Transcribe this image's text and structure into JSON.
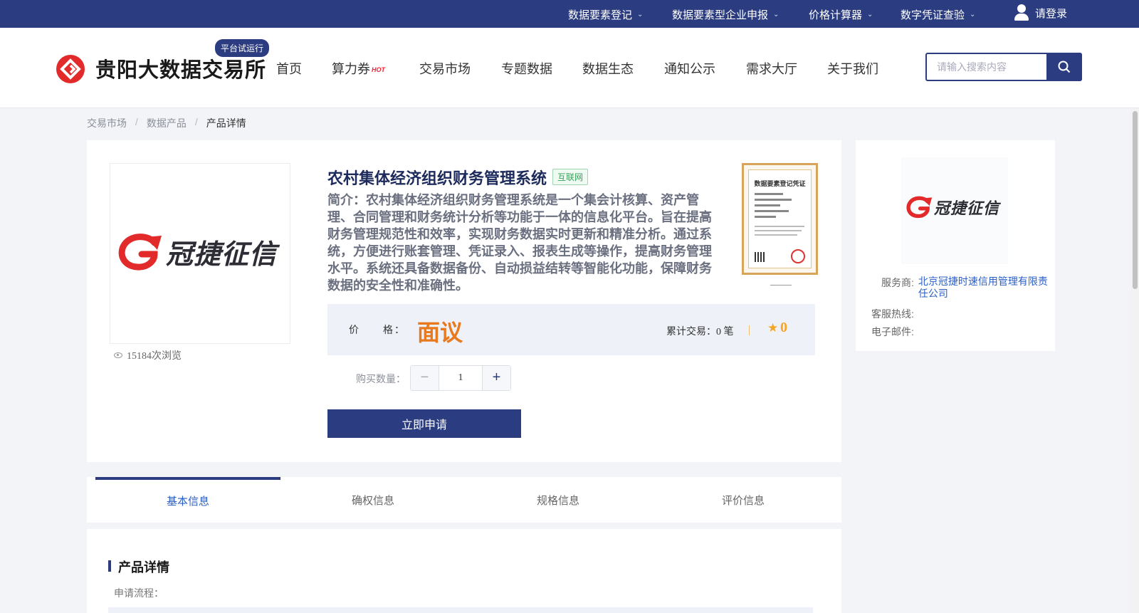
{
  "topbar": {
    "items": [
      {
        "label": "数据要素登记"
      },
      {
        "label": "数据要素型企业申报"
      },
      {
        "label": "价格计算器"
      },
      {
        "label": "数字凭证查验"
      }
    ],
    "login_label": "请登录"
  },
  "header": {
    "site_name": "贵阳大数据交易所",
    "badge": "平台试运行",
    "nav": [
      {
        "label": "首页"
      },
      {
        "label": "算力券",
        "hot": "HOT"
      },
      {
        "label": "交易市场"
      },
      {
        "label": "专题数据"
      },
      {
        "label": "数据生态"
      },
      {
        "label": "通知公示"
      },
      {
        "label": "需求大厅"
      },
      {
        "label": "关于我们"
      }
    ],
    "search_placeholder": "请输入搜索内容"
  },
  "breadcrumb": [
    "交易市场",
    "数据产品",
    "产品详情"
  ],
  "product": {
    "brand_logo_text": "冠捷征信",
    "title": "农村集体经济组织财务管理系统",
    "tag": "互联网",
    "intro": "简介：农村集体经济组织财务管理系统是一个集会计核算、资产管理、合同管理和财务统计分析等功能于一体的信息化平台。旨在提高财务管理规范性和效率，实现财务数据实时更新和精准分析。通过系统，方便进行账套管理、凭证录入、报表生成等操作，提高财务管理水平。系统还具备数据备份、自动损益结转等智能化功能，保障财务数据的安全性和准确性。",
    "views": "15184次浏览",
    "certificate_title": "数据要素登记凭证",
    "price_label": "价　　格：",
    "price_value": "面议",
    "deals_text": "累计交易：0 笔",
    "rating": "0",
    "quantity_label": "购买数量：",
    "quantity": "1",
    "apply_label": "立即申请"
  },
  "provider": {
    "logo_text": "冠捷征信",
    "service_label": "服务商:",
    "service_value": "北京冠捷时速信用管理有限责任公司",
    "hotline_label": "客服热线:",
    "hotline_value": "",
    "email_label": "电子邮件:",
    "email_value": ""
  },
  "tabs": [
    {
      "label": "基本信息"
    },
    {
      "label": "确权信息"
    },
    {
      "label": "规格信息"
    },
    {
      "label": "评价信息"
    }
  ],
  "detail": {
    "title": "产品详情",
    "apply_process_label": "申请流程："
  },
  "colors": {
    "brand": "#2b3c80",
    "accent_orange": "#e8791f",
    "logo_red": "#e22a2a",
    "link": "#2b5fc4"
  }
}
